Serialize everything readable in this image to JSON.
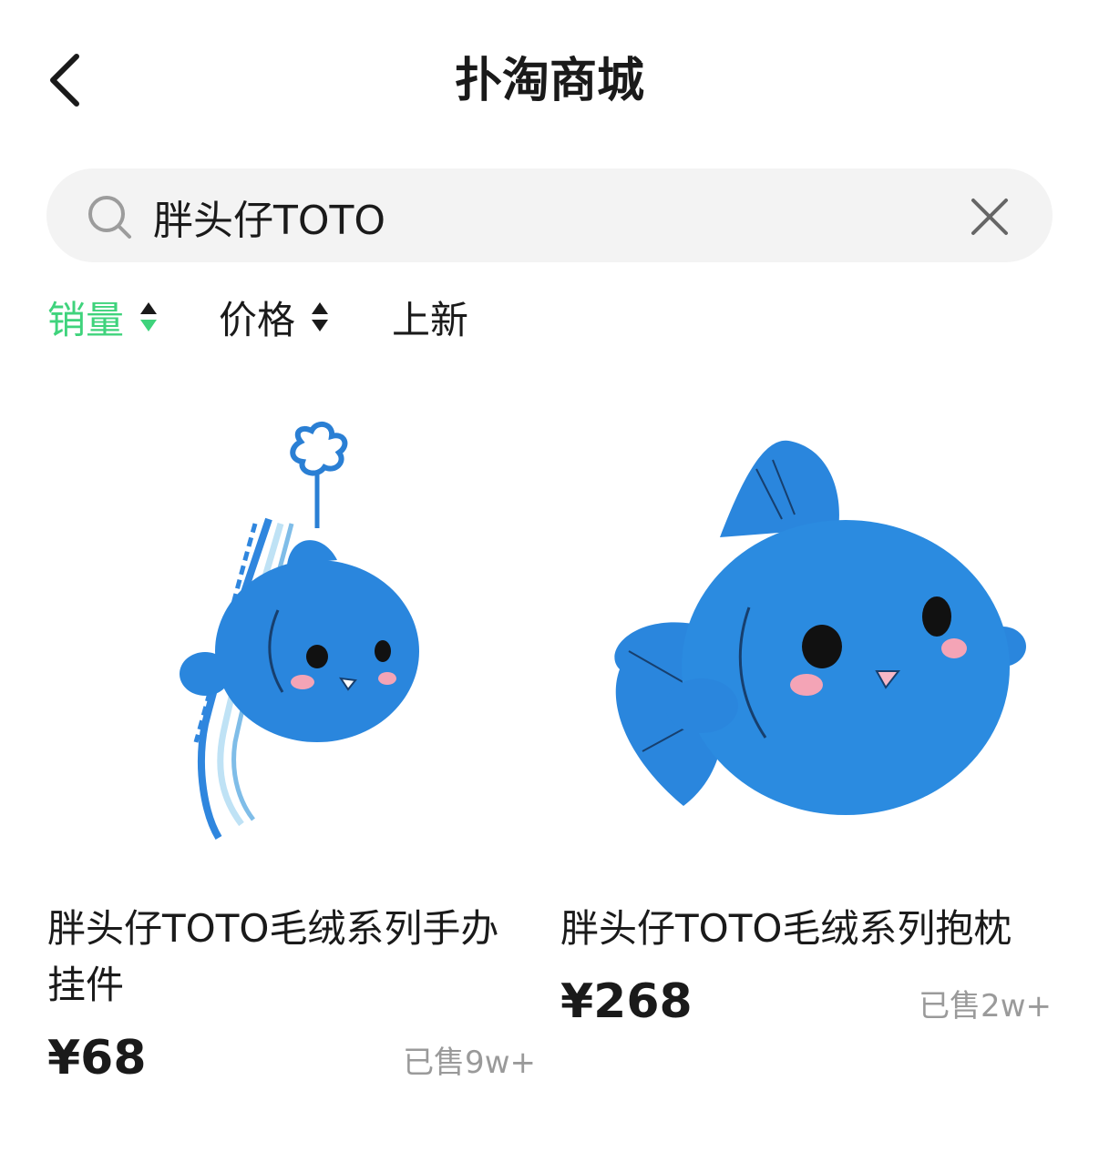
{
  "header": {
    "title": "扑淘商城",
    "back_icon": "chevron-left-icon"
  },
  "search": {
    "query": "胖头仔TOTO",
    "search_icon": "search-icon",
    "clear_icon": "close-icon"
  },
  "sort_tabs": [
    {
      "label": "销量",
      "active": true,
      "has_arrows": true
    },
    {
      "label": "价格",
      "active": false,
      "has_arrows": true
    },
    {
      "label": "上新",
      "active": false,
      "has_arrows": false
    }
  ],
  "colors": {
    "accent_green": "#3fd37c",
    "plush_blue": "#2a86dd",
    "text_dark": "#1a1a1a",
    "text_muted": "#9a9a9a",
    "search_bg": "#f3f3f3"
  },
  "products": [
    {
      "title_line1": "胖头仔TOTO毛绒系列手办",
      "title_line2": "挂件",
      "price": "¥68",
      "sold": "已售9w+"
    },
    {
      "title_line1": "胖头仔TOTO毛绒系列抱枕",
      "title_line2": "",
      "price": "¥268",
      "sold": "已售2w+"
    }
  ]
}
